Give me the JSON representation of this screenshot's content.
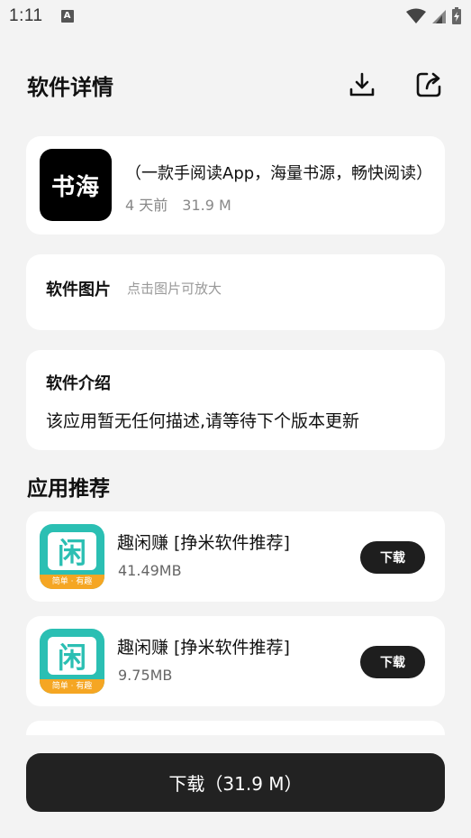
{
  "status_bar": {
    "time": "1:11",
    "notification_icon": "A"
  },
  "header": {
    "title": "软件详情"
  },
  "app": {
    "logo_text": "书海",
    "description": "（一款手阅读App，海量书源，畅快阅读）",
    "updated": "4 天前",
    "size": "31.9 M"
  },
  "images_section": {
    "label": "软件图片",
    "hint": "点击图片可放大"
  },
  "intro_section": {
    "label": "软件介绍",
    "text": "该应用暂无任何描述,请等待下个版本更新"
  },
  "recommend": {
    "title": "应用推荐",
    "items": [
      {
        "name": "趣闲赚 [挣米软件推荐]",
        "size": "41.49MB",
        "button": "下载",
        "icon_char": "闲",
        "icon_band": "简单 · 有趣"
      },
      {
        "name": "趣闲赚 [挣米软件推荐]",
        "size": "9.75MB",
        "button": "下载",
        "icon_char": "闲",
        "icon_band": "简单 · 有趣"
      }
    ]
  },
  "download_button": {
    "label": "下载（31.9 M）"
  },
  "colors": {
    "background": "#f3f3f3",
    "card": "#ffffff",
    "button": "#222222",
    "accent_teal": "#2bbfb3",
    "accent_orange": "#f5a623"
  }
}
